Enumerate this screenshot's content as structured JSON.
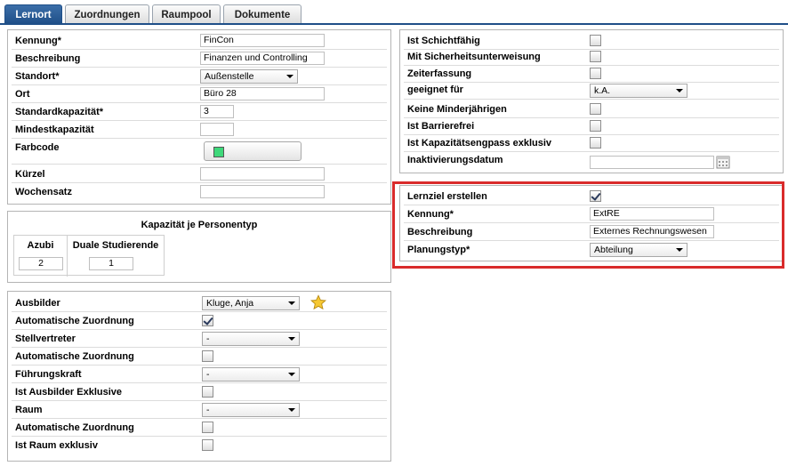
{
  "tabs": [
    {
      "label": "Lernort",
      "active": true
    },
    {
      "label": "Zuordnungen",
      "active": false
    },
    {
      "label": "Raumpool",
      "active": false
    },
    {
      "label": "Dokumente",
      "active": false
    }
  ],
  "general": {
    "kennung_label": "Kennung*",
    "kennung_value": "FinCon",
    "beschreibung_label": "Beschreibung",
    "beschreibung_value": "Finanzen und Controlling",
    "standort_label": "Standort*",
    "standort_value": "Außenstelle",
    "ort_label": "Ort",
    "ort_value": "Büro 28",
    "standardkapazitaet_label": "Standardkapazität*",
    "standardkapazitaet_value": "3",
    "mindestkapazitaet_label": "Mindestkapazität",
    "mindestkapazitaet_value": "",
    "farbcode_label": "Farbcode",
    "farbcode_color": "#3ed87a",
    "kuerzel_label": "Kürzel",
    "kuerzel_value": "",
    "wochensatz_label": "Wochensatz",
    "wochensatz_value": ""
  },
  "capacity": {
    "title": "Kapazität je Personentyp",
    "columns": [
      {
        "label": "Azubi",
        "value": "2"
      },
      {
        "label": "Duale Studierende",
        "value": "1"
      }
    ]
  },
  "assignments": {
    "ausbilder_label": "Ausbilder",
    "ausbilder_value": "Kluge, Anja",
    "auto1_label": "Automatische Zuordnung",
    "auto1_checked": true,
    "stellvertreter_label": "Stellvertreter",
    "stellvertreter_value": "-",
    "auto2_label": "Automatische Zuordnung",
    "auto2_checked": false,
    "fuehrungskraft_label": "Führungskraft",
    "fuehrungskraft_value": "-",
    "ausbilder_exklusiv_label": "Ist Ausbilder Exklusive",
    "ausbilder_exklusiv_checked": false,
    "raum_label": "Raum",
    "raum_value": "-",
    "auto3_label": "Automatische Zuordnung",
    "auto3_checked": false,
    "raum_exklusiv_label": "Ist Raum exklusiv",
    "raum_exklusiv_checked": false
  },
  "flags": {
    "schichtfaehig_label": "Ist Schichtfähig",
    "sicherheit_label": "Mit Sicherheitsunterweisung",
    "zeiterfassung_label": "Zeiterfassung",
    "geeignet_label": "geeignet für",
    "geeignet_value": "k.A.",
    "minderjaehrige_label": "Keine Minderjährigen",
    "barrierefrei_label": "Ist Barrierefrei",
    "engpass_label": "Ist Kapazitätsengpass exklusiv",
    "inaktiv_label": "Inaktivierungsdatum",
    "inaktiv_value": ""
  },
  "lernziel": {
    "erstellen_label": "Lernziel erstellen",
    "erstellen_checked": true,
    "kennung_label": "Kennung*",
    "kennung_value": "ExtRE",
    "beschreibung_label": "Beschreibung",
    "beschreibung_value": "Externes Rechnungswesen",
    "planungstyp_label": "Planungstyp*",
    "planungstyp_value": "Abteilung"
  },
  "colors": {
    "accent": "#1f4f88",
    "highlight": "#d92b2b"
  }
}
